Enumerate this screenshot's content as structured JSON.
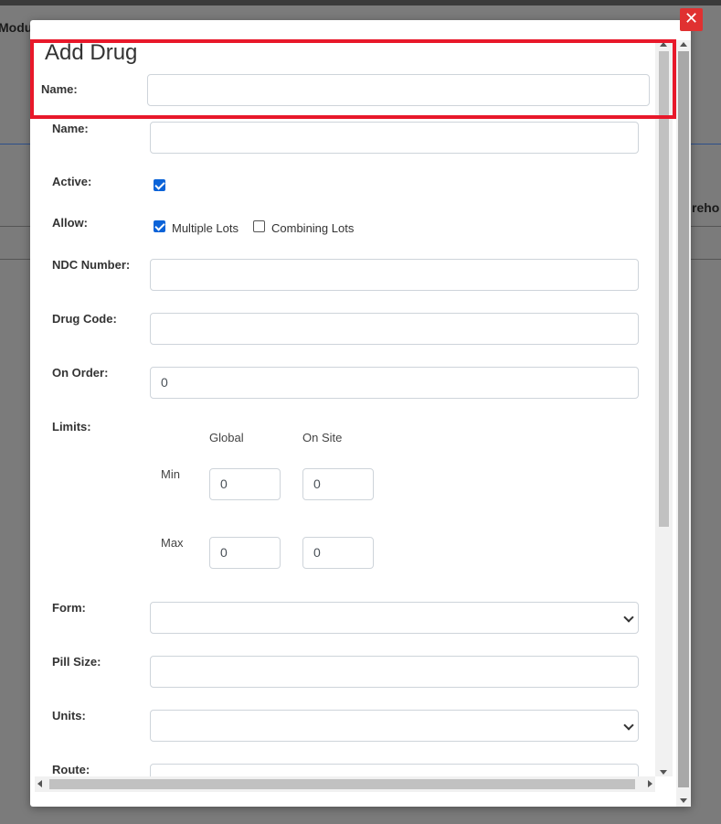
{
  "background": {
    "left_fragment": "Modul",
    "right_fragment": "reho"
  },
  "modal": {
    "title": "Add Drug",
    "close_icon": "close-icon",
    "highlight_color": "#e8182a",
    "accent_color": "#0b63d8"
  },
  "fields": {
    "name_top": {
      "label": "Name:",
      "value": ""
    },
    "name": {
      "label": "Name:",
      "value": ""
    },
    "active": {
      "label": "Active:",
      "checked": true
    },
    "allow": {
      "label": "Allow:",
      "multiple_lots": {
        "label": "Multiple Lots",
        "checked": true
      },
      "combining_lots": {
        "label": "Combining Lots",
        "checked": false
      }
    },
    "ndc_number": {
      "label": "NDC Number:",
      "value": ""
    },
    "drug_code": {
      "label": "Drug Code:",
      "value": ""
    },
    "on_order": {
      "label": "On Order:",
      "value": "0"
    },
    "limits": {
      "label": "Limits:",
      "col_global": "Global",
      "col_on_site": "On Site",
      "row_min": "Min",
      "row_max": "Max",
      "min_global": "0",
      "min_on_site": "0",
      "max_global": "0",
      "max_on_site": "0"
    },
    "form": {
      "label": "Form:",
      "selected": ""
    },
    "pill_size": {
      "label": "Pill Size:",
      "value": ""
    },
    "units": {
      "label": "Units:",
      "selected": ""
    },
    "route": {
      "label": "Route:",
      "value": ""
    }
  }
}
